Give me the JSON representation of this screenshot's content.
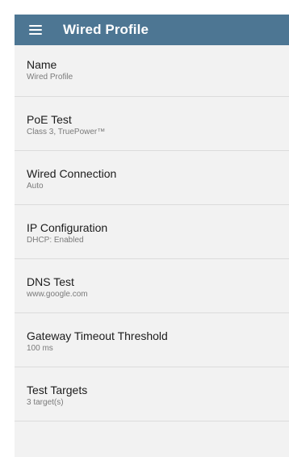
{
  "app_bar": {
    "title": "Wired Profile",
    "menu_icon": "hamburger-menu-icon",
    "background_color": "#4d7693"
  },
  "settings": [
    {
      "title": "Name",
      "value": "Wired Profile"
    },
    {
      "title": "PoE Test",
      "value": "Class 3, TruePower™"
    },
    {
      "title": "Wired Connection",
      "value": "Auto"
    },
    {
      "title": "IP Configuration",
      "value": "DHCP: Enabled"
    },
    {
      "title": "DNS Test",
      "value": "www.google.com"
    },
    {
      "title": "Gateway Timeout Threshold",
      "value": "100 ms"
    },
    {
      "title": "Test Targets",
      "value": "3 target(s)"
    }
  ]
}
